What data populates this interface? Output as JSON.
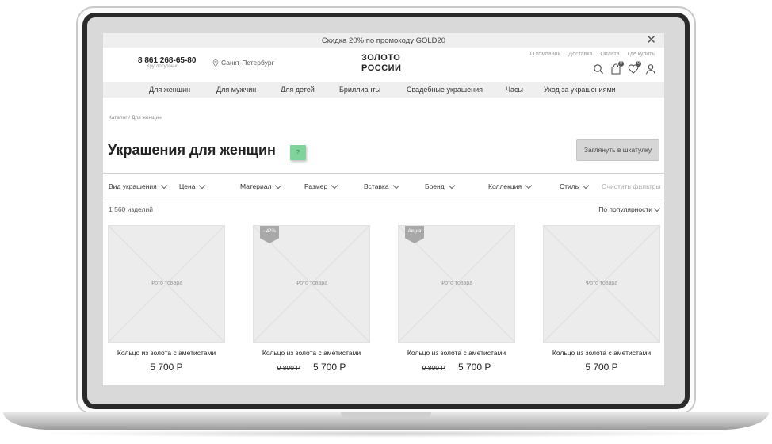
{
  "promo": {
    "text": "Скидка 20%  по промокоду GOLD20",
    "close": "✕"
  },
  "header": {
    "phone": "8 861 268-65-80",
    "phone_sub": "Круглосуточно",
    "city": "Санкт-Петербург",
    "logo_line1": "ЗОЛОТО",
    "logo_line2": "РОССИИ",
    "top_links": [
      "О компании",
      "Доставка",
      "Оплата",
      "Где купить"
    ],
    "icons": [
      "search-icon",
      "bag-icon",
      "heart-icon",
      "user-icon"
    ],
    "badges": {
      "bag": "0",
      "heart": "0"
    }
  },
  "nav": [
    "Для женщин",
    "Для мужчин",
    "Для детей",
    "Бриллианты",
    "Свадебные украшения",
    "Часы",
    "Уход за украшениями"
  ],
  "breadcrumb": "Каталог / Для женщин",
  "page_title": "Украшения для женщин",
  "help_badge": "?",
  "box_button": "Заглянуть в шкатулку",
  "filters": [
    "Вид украшения",
    "Цена",
    "Материал",
    "Размер",
    "Вставка",
    "Бренд",
    "Коллекция",
    "Стиль"
  ],
  "filter_clear": "Очистить фильтры",
  "count": "1 560 изделий",
  "sort": "По популярности",
  "products": [
    {
      "photo": "Фото товара",
      "tag": "",
      "name": "Кольцо из золота с аметистами",
      "old_price": "",
      "price": "5 700 Р"
    },
    {
      "photo": "Фото товара",
      "tag": "- 42%",
      "name": "Кольцо из золота с аметистами",
      "old_price": "9 800 Р",
      "price": "5 700 Р"
    },
    {
      "photo": "Фото товара",
      "tag": "Акция",
      "name": "Кольцо из золота с аметистами",
      "old_price": "9 800 Р",
      "price": "5 700 Р"
    },
    {
      "photo": "Фото товара",
      "tag": "",
      "name": "Кольцо из золота с аметистами",
      "old_price": "",
      "price": "5 700 Р"
    }
  ],
  "colors": {
    "help_badge": "#7fd39b",
    "nav_bg": "#efefef",
    "tag_bg": "#a8a8a8"
  }
}
